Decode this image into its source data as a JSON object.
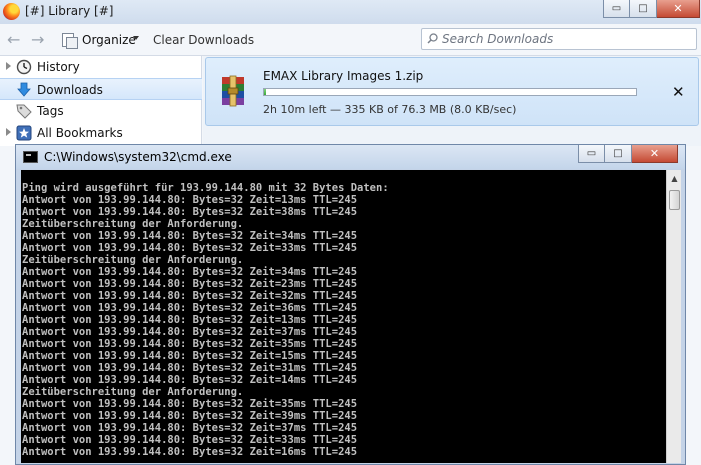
{
  "library": {
    "title": "[#] Library [#]",
    "buttons": {
      "minimize": "▭",
      "maximize": "□",
      "close": "✕"
    },
    "toolbar": {
      "organize_label": "Organize",
      "clear_downloads_label": "Clear Downloads",
      "search_placeholder": "Search Downloads"
    },
    "sidebar": {
      "items": [
        {
          "label": "History",
          "icon": "clock-icon"
        },
        {
          "label": "Downloads",
          "icon": "download-arrow-icon",
          "selected": true
        },
        {
          "label": "Tags",
          "icon": "tag-icon"
        },
        {
          "label": "All Bookmarks",
          "icon": "bookmark-star-icon"
        }
      ]
    },
    "download": {
      "filename": "EMAX Library Images 1.zip",
      "status": "2h 10m left — 335 KB of 76.3 MB (8.0 KB/sec)",
      "progress": 0.0043,
      "cancel": "✕"
    }
  },
  "cmd": {
    "title": "C:\\Windows\\system32\\cmd.exe",
    "buttons": {
      "minimize": "▭",
      "maximize": "□",
      "close": "✕"
    },
    "lines": [
      "",
      "Ping wird ausgeführt für 193.99.144.80 mit 32 Bytes Daten:",
      "Antwort von 193.99.144.80: Bytes=32 Zeit=13ms TTL=245",
      "Antwort von 193.99.144.80: Bytes=32 Zeit=38ms TTL=245",
      "Zeitüberschreitung der Anforderung.",
      "Antwort von 193.99.144.80: Bytes=32 Zeit=34ms TTL=245",
      "Antwort von 193.99.144.80: Bytes=32 Zeit=33ms TTL=245",
      "Zeitüberschreitung der Anforderung.",
      "Antwort von 193.99.144.80: Bytes=32 Zeit=34ms TTL=245",
      "Antwort von 193.99.144.80: Bytes=32 Zeit=23ms TTL=245",
      "Antwort von 193.99.144.80: Bytes=32 Zeit=32ms TTL=245",
      "Antwort von 193.99.144.80: Bytes=32 Zeit=36ms TTL=245",
      "Antwort von 193.99.144.80: Bytes=32 Zeit=13ms TTL=245",
      "Antwort von 193.99.144.80: Bytes=32 Zeit=37ms TTL=245",
      "Antwort von 193.99.144.80: Bytes=32 Zeit=35ms TTL=245",
      "Antwort von 193.99.144.80: Bytes=32 Zeit=15ms TTL=245",
      "Antwort von 193.99.144.80: Bytes=32 Zeit=31ms TTL=245",
      "Antwort von 193.99.144.80: Bytes=32 Zeit=14ms TTL=245",
      "Zeitüberschreitung der Anforderung.",
      "Antwort von 193.99.144.80: Bytes=32 Zeit=35ms TTL=245",
      "Antwort von 193.99.144.80: Bytes=32 Zeit=39ms TTL=245",
      "Antwort von 193.99.144.80: Bytes=32 Zeit=37ms TTL=245",
      "Antwort von 193.99.144.80: Bytes=32 Zeit=33ms TTL=245",
      "Antwort von 193.99.144.80: Bytes=32 Zeit=16ms TTL=245"
    ]
  },
  "colors": {
    "console_bg": "#000000",
    "console_text": "#c0c0c0",
    "progress_fill": "#3aa83a",
    "close_button": "#c54a34"
  }
}
